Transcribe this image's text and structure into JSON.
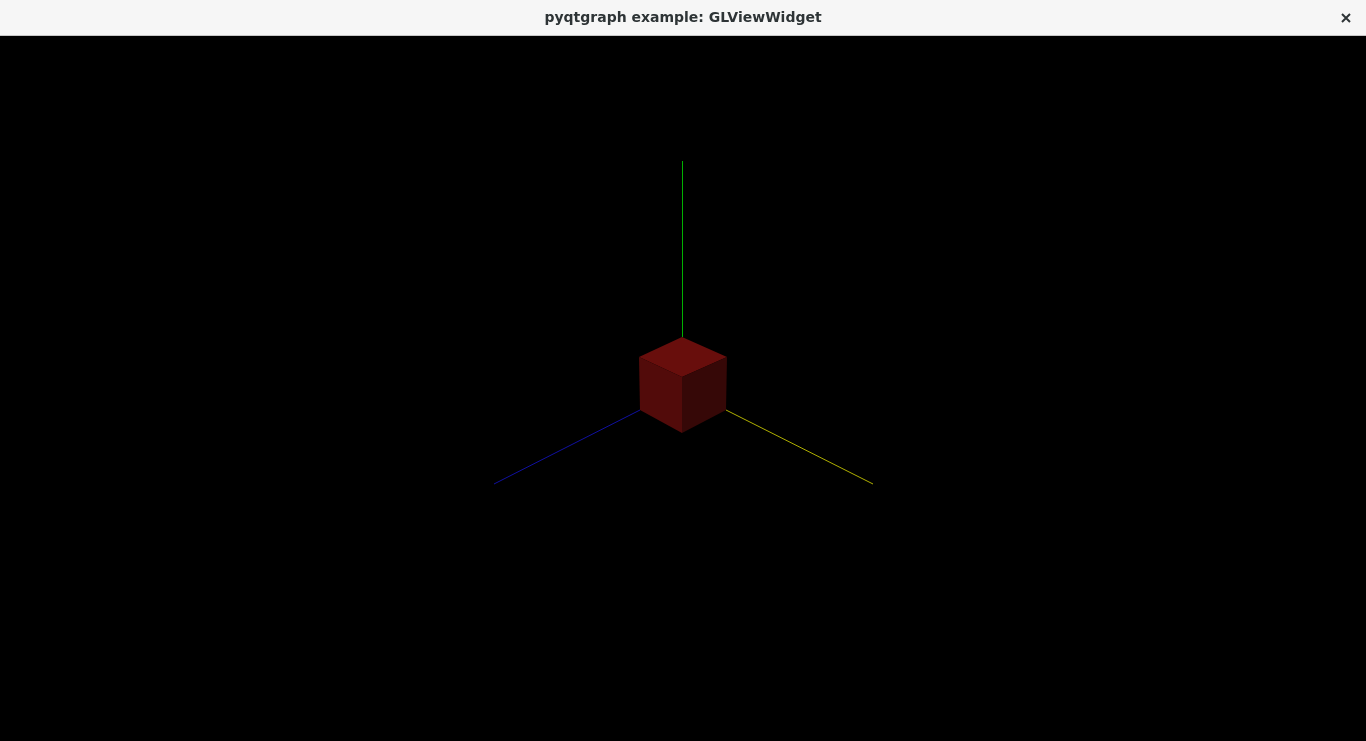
{
  "window": {
    "title": "pyqtgraph example: GLViewWidget"
  }
}
